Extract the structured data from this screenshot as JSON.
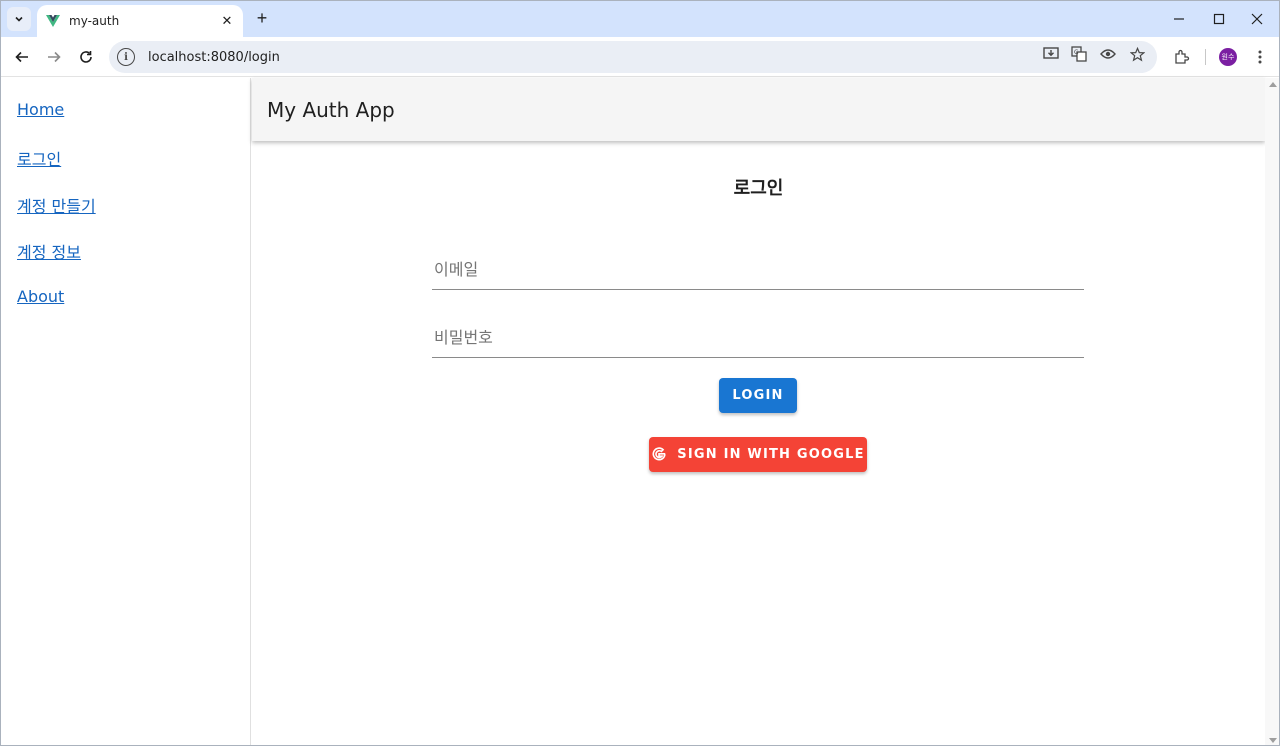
{
  "browser": {
    "tab": {
      "title": "my-auth"
    },
    "url": "localhost:8080/login",
    "profile_initials": "원수"
  },
  "sidebar": {
    "items": [
      {
        "label": "Home"
      },
      {
        "label": "로그인"
      },
      {
        "label": "계정 만들기"
      },
      {
        "label": "계정 정보"
      },
      {
        "label": "About"
      }
    ]
  },
  "app_bar": {
    "title": "My Auth App"
  },
  "login": {
    "heading": "로그인",
    "email_placeholder": "이메일",
    "password_placeholder": "비밀번호",
    "login_button": "LOGIN",
    "google_button": "SIGN IN WITH GOOGLE"
  },
  "colors": {
    "primary": "#1976d2",
    "google": "#f44336",
    "link": "#1565c0",
    "tabstrip": "#d3e3fd"
  }
}
